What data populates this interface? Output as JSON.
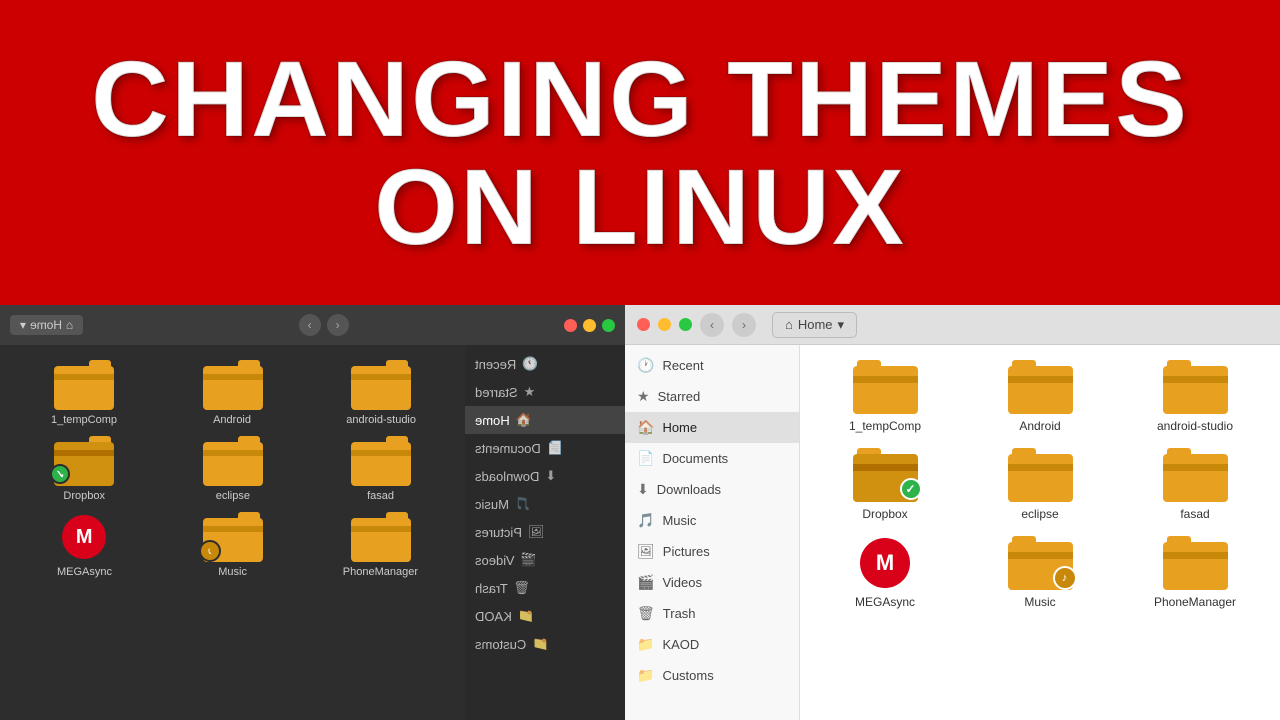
{
  "banner": {
    "line1": "CHANGING THEMES",
    "line2": "ON LINUX"
  },
  "left_window": {
    "title": "Home",
    "sidebar": [
      {
        "label": "Recent",
        "icon": "🕐",
        "active": false
      },
      {
        "label": "Starred",
        "icon": "★",
        "active": false
      },
      {
        "label": "Home",
        "icon": "🏠",
        "active": true
      },
      {
        "label": "Documents",
        "icon": "📄",
        "active": false
      },
      {
        "label": "Downloads",
        "icon": "⬇",
        "active": false
      },
      {
        "label": "Music",
        "icon": "🎵",
        "active": false
      },
      {
        "label": "Pictures",
        "icon": "🖼",
        "active": false
      },
      {
        "label": "Videos",
        "icon": "🎬",
        "active": false
      },
      {
        "label": "Trash",
        "icon": "🗑",
        "active": false
      },
      {
        "label": "KAOD",
        "icon": "📁",
        "active": false
      },
      {
        "label": "Customs",
        "icon": "📁",
        "active": false
      }
    ],
    "files": [
      {
        "name": "android-studio",
        "type": "folder",
        "badge": null
      },
      {
        "name": "Android",
        "type": "folder",
        "badge": null
      },
      {
        "name": "1_tempComp",
        "type": "folder",
        "badge": null
      },
      {
        "name": "fasad",
        "type": "folder",
        "badge": null
      },
      {
        "name": "eclipse",
        "type": "folder",
        "badge": null
      },
      {
        "name": "Dropbox",
        "type": "folder",
        "badge": "green"
      },
      {
        "name": "PhoneManager",
        "type": "folder",
        "badge": null
      },
      {
        "name": "Music",
        "type": "folder",
        "badge": "music"
      },
      {
        "name": "MEGAsync",
        "type": "mega",
        "badge": null
      }
    ]
  },
  "right_window": {
    "title": "Home",
    "sidebar": [
      {
        "label": "Recent",
        "icon": "🕐",
        "active": false
      },
      {
        "label": "Starred",
        "icon": "★",
        "active": false
      },
      {
        "label": "Home",
        "icon": "🏠",
        "active": true
      },
      {
        "label": "Documents",
        "icon": "📄",
        "active": false
      },
      {
        "label": "Downloads",
        "icon": "⬇",
        "active": false
      },
      {
        "label": "Music",
        "icon": "🎵",
        "active": false
      },
      {
        "label": "Pictures",
        "icon": "🖼",
        "active": false
      },
      {
        "label": "Videos",
        "icon": "🎬",
        "active": false
      },
      {
        "label": "Trash",
        "icon": "🗑",
        "active": false
      },
      {
        "label": "KAOD",
        "icon": "📁",
        "active": false
      },
      {
        "label": "Customs",
        "icon": "📁",
        "active": false
      }
    ],
    "files": [
      {
        "name": "1_tempComp",
        "type": "folder",
        "badge": null
      },
      {
        "name": "Android",
        "type": "folder",
        "badge": null
      },
      {
        "name": "android-studio",
        "type": "folder",
        "badge": null
      },
      {
        "name": "Dropbox",
        "type": "folder",
        "badge": "green"
      },
      {
        "name": "eclipse",
        "type": "folder",
        "badge": null
      },
      {
        "name": "fasad",
        "type": "folder",
        "badge": null
      },
      {
        "name": "MEGAsync",
        "type": "mega",
        "badge": null
      },
      {
        "name": "Music",
        "type": "folder",
        "badge": "music"
      },
      {
        "name": "PhoneManager",
        "type": "folder",
        "badge": null
      }
    ]
  },
  "icons": {
    "back": "‹",
    "forward": "›",
    "home": "⌂",
    "dropdown": "▾",
    "checkmark": "✓",
    "music_note": "♪",
    "mega_letter": "M"
  }
}
